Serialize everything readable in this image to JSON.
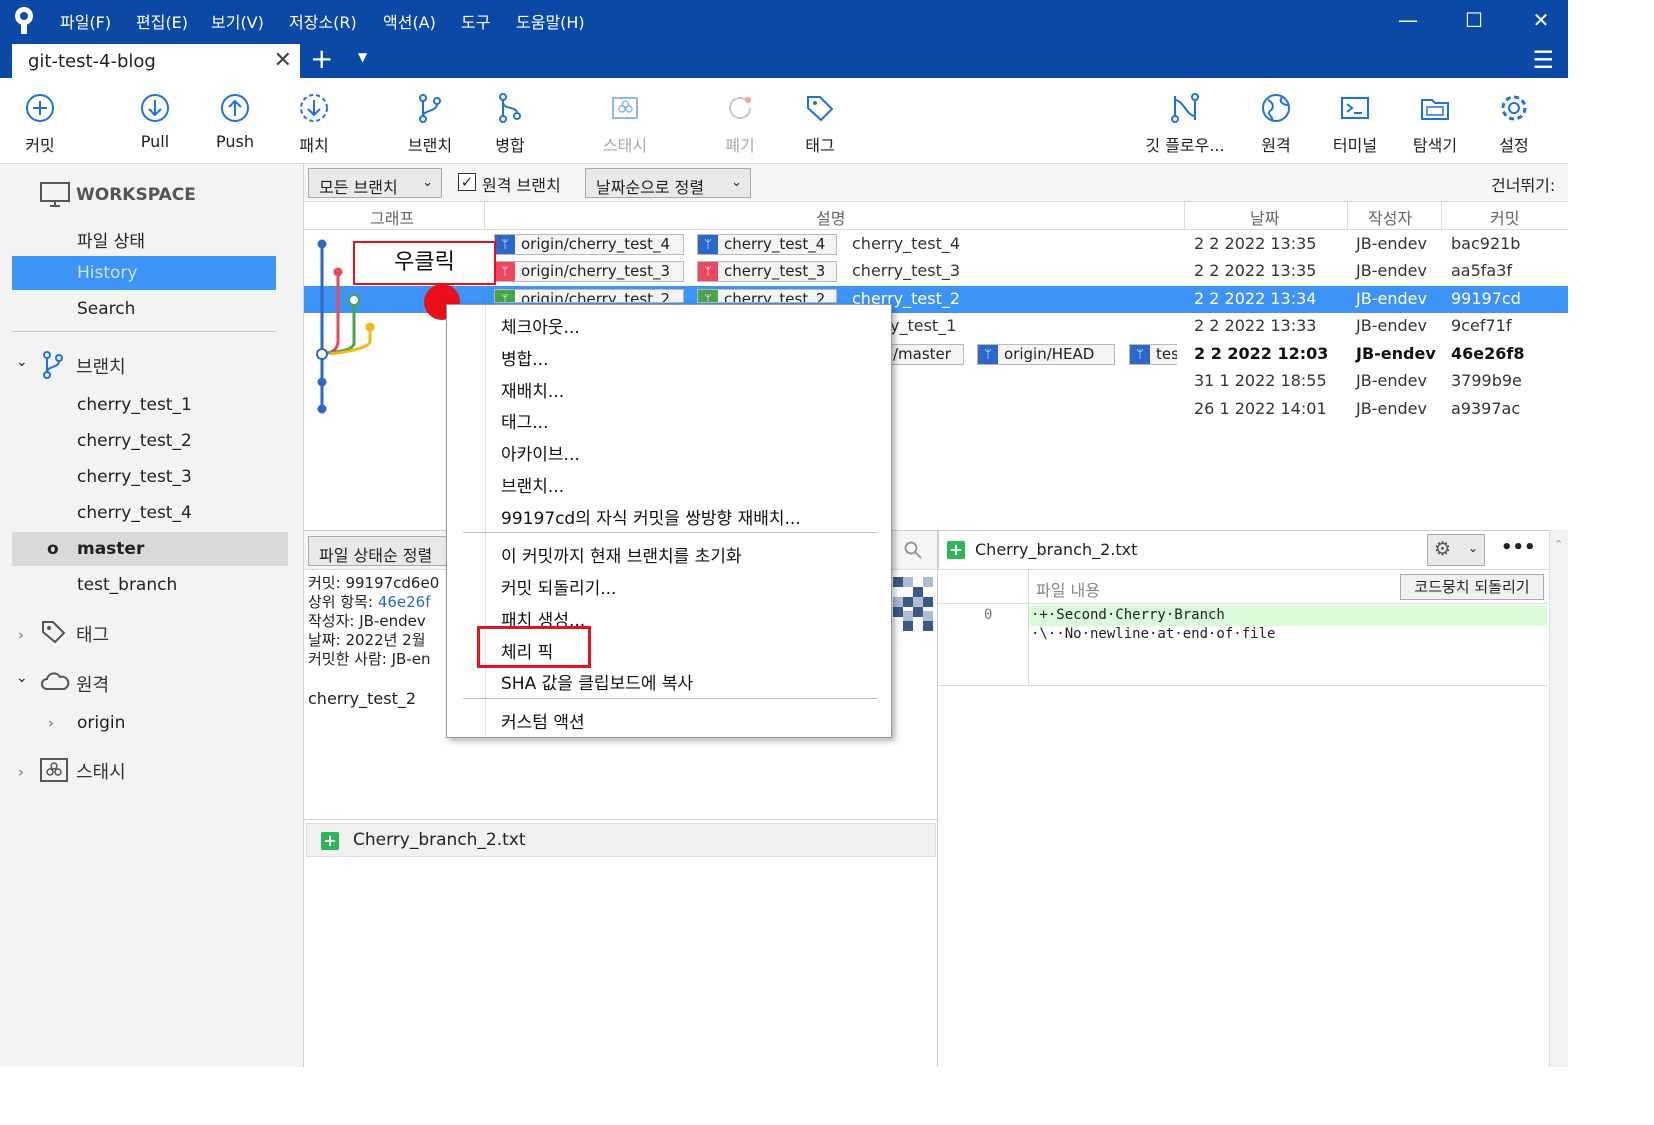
{
  "app": {
    "menu": [
      "파일(F)",
      "편집(E)",
      "보기(V)",
      "저장소(R)",
      "액션(A)",
      "도구",
      "도움말(H)"
    ],
    "window_controls": {
      "minimize": "—",
      "maximize": "☐",
      "close": "✕"
    }
  },
  "tabs": {
    "active": "git-test-4-blog",
    "add": "+",
    "close": "✕"
  },
  "toolbar": {
    "commit": "커밋",
    "pull": "Pull",
    "push": "Push",
    "patch": "패치",
    "branch": "브랜치",
    "merge": "병합",
    "stash": "스태시",
    "discard": "폐기",
    "tag": "태그",
    "gitflow": "깃 플로우...",
    "remote": "원격",
    "terminal": "터미널",
    "explorer": "탐색기",
    "settings": "설정"
  },
  "sidebar": {
    "workspace": "WORKSPACE",
    "file_status": "파일 상태",
    "history": "History",
    "search": "Search",
    "branches_title": "브랜치",
    "branches": [
      "cherry_test_1",
      "cherry_test_2",
      "cherry_test_3",
      "cherry_test_4",
      "master",
      "test_branch"
    ],
    "current_branch_marker": "o",
    "tags_title": "태그",
    "remotes_title": "원격",
    "remotes": [
      "origin"
    ],
    "stash_title": "스태시"
  },
  "filter": {
    "branches_combo": "모든 브랜치",
    "remote_branches": "원격 브랜치",
    "sort_combo": "날짜순으로 정렬",
    "jump": "건너뛰기:"
  },
  "columns": {
    "graph": "그래프",
    "description": "설명",
    "date": "날짜",
    "author": "작성자",
    "commit": "커밋"
  },
  "annotation": {
    "right_click": "우클릭"
  },
  "commits": [
    {
      "refs": [
        "origin/cherry_test_4",
        "cherry_test_4"
      ],
      "desc": "cherry_test_4",
      "date": "2 2 2022 13:35",
      "author": "JB-endev",
      "hash": "bac921b"
    },
    {
      "refs": [
        "origin/cherry_test_3",
        "cherry_test_3"
      ],
      "desc": "cherry_test_3",
      "date": "2 2 2022 13:35",
      "author": "JB-endev",
      "hash": "aa5fa3f"
    },
    {
      "refs": [
        "origin/cherry_test_2",
        "cherry_test_2"
      ],
      "desc": "cherry_test_2",
      "date": "2 2 2022 13:34",
      "author": "JB-endev",
      "hash": "99197cd"
    },
    {
      "refs": [],
      "desc": "y_test_1",
      "date": "2 2 2022 13:33",
      "author": "JB-endev",
      "hash": "9cef71f"
    },
    {
      "refs": [
        "/master",
        "origin/HEAD",
        "tes"
      ],
      "desc": "",
      "date": "2 2 2022 12:03",
      "author": "JB-endev",
      "hash": "46e26f8"
    },
    {
      "refs": [],
      "desc": "",
      "date": "31 1 2022 18:55",
      "author": "JB-endev",
      "hash": "3799b9e"
    },
    {
      "refs": [],
      "desc": "",
      "date": "26 1 2022 14:01",
      "author": "JB-endev",
      "hash": "a9397ac"
    }
  ],
  "context_menu": {
    "group1": [
      "체크아웃...",
      "병합...",
      "재배치...",
      "태그...",
      "아카이브...",
      "브랜치...",
      "99197cd의 자식 커밋을 쌍방향 재배치..."
    ],
    "group2": [
      "이 커밋까지 현재 브랜치를 초기화",
      "커밋 되돌리기...",
      "패치 생성...",
      "체리 픽",
      "SHA 값을 클립보드에 복사"
    ],
    "group3": [
      "커스텀 액션"
    ]
  },
  "details": {
    "sort_combo": "파일 상태순 정렬",
    "commit_line_label": "커밋:",
    "commit_line_value": "99197cd6e0",
    "parent_label": "상위 항목:",
    "parent_value": "46e26f",
    "author_label": "작성자:",
    "author_value": "JB-endev",
    "date_label": "날짜:",
    "date_value": "2022년 2월",
    "committer_label": "커밋한 사람:",
    "committer_value": "JB-en",
    "message": "cherry_test_2",
    "file": "Cherry_branch_2.txt"
  },
  "diff": {
    "file": "Cherry_branch_2.txt",
    "header": "파일 내용",
    "revert_hunk": "코드뭉치 되돌리기",
    "line_no": "0",
    "lines": [
      "·+·Second·Cherry·Branch",
      "·\\··No·newline·at·end·of·file"
    ],
    "more": "•••"
  },
  "colors": {
    "titlebar": "#0a4aa6",
    "selection": "#3d94f6",
    "highlight_red": "#e8101a",
    "add_green": "#2fb457"
  }
}
